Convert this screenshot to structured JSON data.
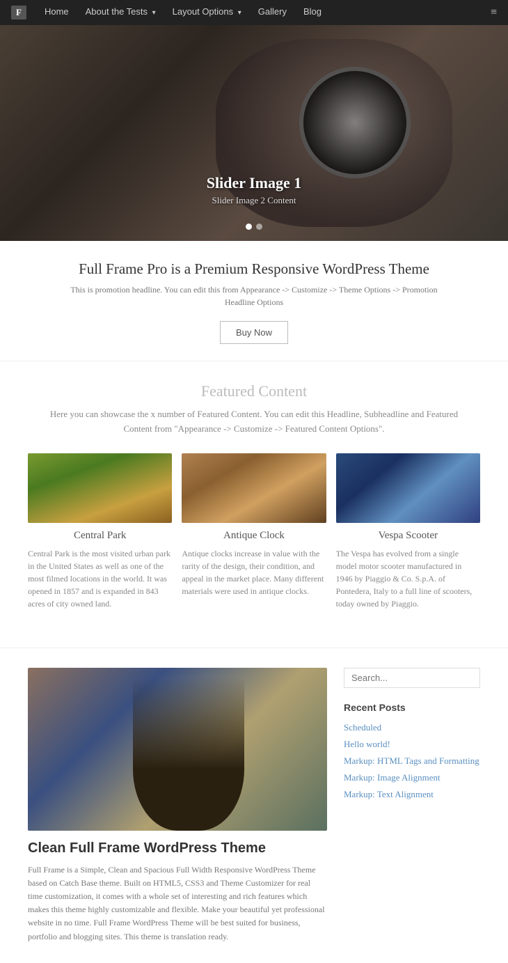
{
  "nav": {
    "logo": "F",
    "items": [
      {
        "label": "Home",
        "href": "#",
        "dropdown": false
      },
      {
        "label": "About the Tests",
        "href": "#",
        "dropdown": true
      },
      {
        "label": "Layout Options",
        "href": "#",
        "dropdown": true
      },
      {
        "label": "Gallery",
        "href": "#",
        "dropdown": false
      },
      {
        "label": "Blog",
        "href": "#",
        "dropdown": false
      }
    ]
  },
  "hero": {
    "title": "Slider Image 1",
    "subtitle": "Slider Image 2 Content",
    "dots": [
      {
        "active": true
      },
      {
        "active": false
      }
    ]
  },
  "promo": {
    "title": "Full Frame Pro is a Premium Responsive WordPress Theme",
    "description": "This is promotion headline. You can edit this from Appearance -> Customize -> Theme Options -> Promotion Headline Options",
    "button_label": "Buy Now"
  },
  "featured": {
    "title": "Featured Content",
    "description": "Here you can showcase the x number of Featured Content. You can edit this Headline, Subheadline and Featured Content from \"Appearance -> Customize -> Featured Content Options\".",
    "cards": [
      {
        "title": "Central Park",
        "description": "Central Park is the most visited urban park in the United States as well as one of the most filmed locations in the world. It was opened in 1857 and is expanded in 843 acres of city owned land.",
        "img_type": "park"
      },
      {
        "title": "Antique Clock",
        "description": "Antique clocks increase in value with the rarity of the design, their condition, and appeal in the market place. Many different materials were used in antique clocks.",
        "img_type": "clock"
      },
      {
        "title": "Vespa Scooter",
        "description": "The Vespa has evolved from a single model motor scooter manufactured in 1946 by Piaggio & Co. S.p.A. of Pontedera, Italy to a full line of scooters, today owned by Piaggio.",
        "img_type": "vespa"
      }
    ]
  },
  "lower_post": {
    "title": "Clean Full Frame WordPress Theme",
    "description": "Full Frame is a Simple, Clean and Spacious Full Width Responsive WordPress Theme based on Catch Base theme. Built on HTML5, CSS3 and Theme Customizer for real time customization, it comes with a whole set of interesting and rich features which makes this theme highly customizable and flexible. Make your beautiful yet professional website in no time. Full Frame WordPress Theme will be best suited for business, portfolio and blogging sites. This theme is translation ready."
  },
  "sidebar": {
    "search_placeholder": "Search...",
    "recent_posts_title": "Recent Posts",
    "recent_posts": [
      {
        "label": "Scheduled",
        "href": "#"
      },
      {
        "label": "Hello world!",
        "href": "#"
      },
      {
        "label": "Markup: HTML Tags and Formatting",
        "href": "#"
      },
      {
        "label": "Markup: Image Alignment",
        "href": "#"
      },
      {
        "label": "Markup: Text Alignment",
        "href": "#"
      }
    ]
  }
}
